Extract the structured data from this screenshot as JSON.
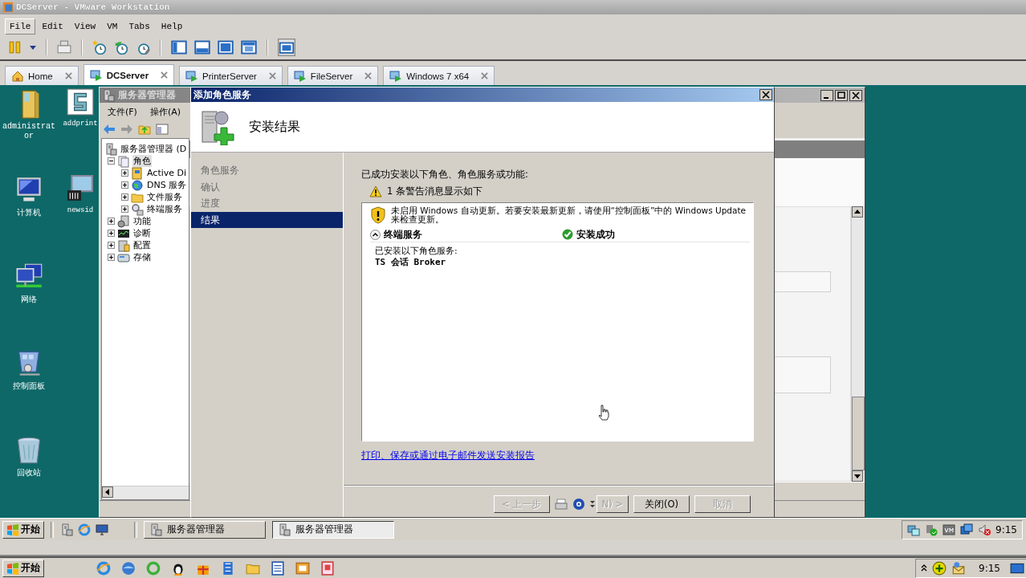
{
  "app": {
    "title": "DCServer - VMware Workstation",
    "menu": [
      {
        "label": "File",
        "highlighted": true
      },
      {
        "label": "Edit",
        "highlighted": false
      },
      {
        "label": "View",
        "highlighted": false
      },
      {
        "label": "VM",
        "highlighted": false
      },
      {
        "label": "Tabs",
        "highlighted": false
      },
      {
        "label": "Help",
        "highlighted": false
      }
    ]
  },
  "tabs": [
    {
      "label": "Home",
      "kind": "home",
      "selected": false
    },
    {
      "label": "DCServer",
      "kind": "vm",
      "selected": true
    },
    {
      "label": "PrinterServer",
      "kind": "vm",
      "selected": false
    },
    {
      "label": "FileServer",
      "kind": "vm",
      "selected": false
    },
    {
      "label": "Windows 7 x64",
      "kind": "vm",
      "selected": false
    }
  ],
  "desktop": {
    "columns": [
      [
        {
          "label": "administrator",
          "kind": "folder"
        },
        {
          "label": "计算机",
          "kind": "computer"
        },
        {
          "label": "网络",
          "kind": "network"
        },
        {
          "label": "控制面板",
          "kind": "control-panel"
        },
        {
          "label": "回收站",
          "kind": "recycle-bin"
        }
      ],
      [
        {
          "label": "addprint",
          "kind": "script"
        },
        {
          "label": "newsid",
          "kind": "tool"
        }
      ]
    ]
  },
  "server_manager": {
    "title": "服务器管理器",
    "menu": [
      "文件(F)",
      "操作(A)"
    ],
    "tree": [
      {
        "label": "服务器管理器 (D",
        "kind": "server",
        "selected": false,
        "children": [
          {
            "label": "角色",
            "kind": "roles",
            "expanded": true,
            "selected": true,
            "children": [
              {
                "label": "Active Di",
                "kind": "directory",
                "expanded": false,
                "selected": false
              },
              {
                "label": "DNS 服务",
                "kind": "dns",
                "expanded": false,
                "selected": false
              },
              {
                "label": "文件服务",
                "kind": "files",
                "expanded": false,
                "selected": false
              },
              {
                "label": "终端服务",
                "kind": "terminal",
                "expanded": false,
                "selected": false
              }
            ]
          },
          {
            "label": "功能",
            "kind": "features",
            "expanded": false,
            "selected": false
          },
          {
            "label": "诊断",
            "kind": "diagnostics",
            "expanded": false,
            "selected": false
          },
          {
            "label": "配置",
            "kind": "config",
            "expanded": false,
            "selected": false
          },
          {
            "label": "存储",
            "kind": "storage",
            "expanded": false,
            "selected": false
          }
        ]
      }
    ]
  },
  "dialog": {
    "title": "添加角色服务",
    "heading": "安装结果",
    "steps": [
      {
        "label": "角色服务",
        "selected": false
      },
      {
        "label": "确认",
        "selected": false
      },
      {
        "label": "进度",
        "selected": false
      },
      {
        "label": "结果",
        "selected": true
      }
    ],
    "intro": "已成功安装以下角色、角色服务或功能:",
    "warning_summary": "1 条警告消息显示如下",
    "messages": [
      {
        "kind": "warning",
        "text": "未启用 Windows 自动更新。若要安装最新更新，请使用“控制面板”中的 Windows Update 来检查更新。"
      }
    ],
    "results": [
      {
        "title": "终端服务",
        "expanded": true,
        "status": "安装成功",
        "kind": "success",
        "details": [
          {
            "text": "已安装以下角色服务:",
            "bold": false
          },
          {
            "text": "TS 会话 Broker",
            "bold": true
          }
        ]
      }
    ],
    "report_link": "打印、保存或通过电子邮件发送安装报告",
    "buttons": [
      {
        "label": "< 上一步",
        "kind": "back",
        "disabled": true
      },
      {
        "label": "N) >",
        "kind": "next",
        "disabled": true
      },
      {
        "label": "关闭(O)",
        "kind": "close",
        "disabled": false
      },
      {
        "label": "取消",
        "kind": "cancel",
        "disabled": true
      }
    ]
  },
  "guest_taskbar": {
    "start": "开始",
    "tasks": [
      {
        "label": "服务器管理器",
        "selected": false
      },
      {
        "label": "服务器管理器",
        "selected": true
      }
    ],
    "clock": "9:15"
  },
  "host_taskbar": {
    "start": "开始",
    "clock": "9:15"
  }
}
